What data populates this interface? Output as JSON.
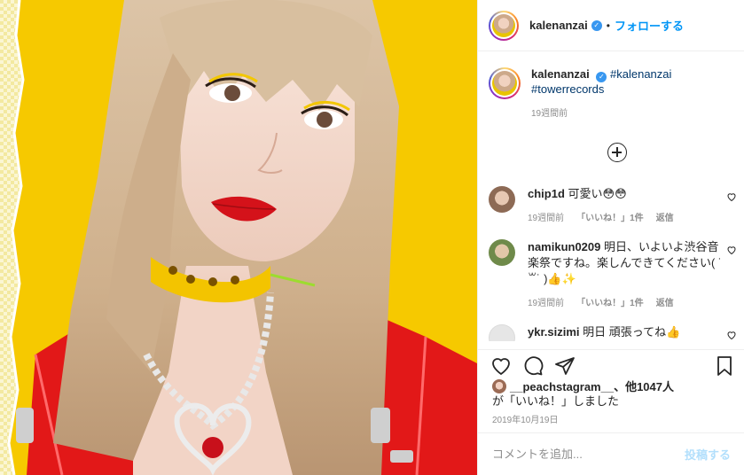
{
  "post": {
    "author": "kalenanzai",
    "follow_label": "フォローする",
    "separator": "•"
  },
  "caption": {
    "author": "kalenanzai",
    "hashtags": [
      "#kalenanzai",
      "#towerrecords"
    ],
    "time": "19週間前"
  },
  "comments": [
    {
      "user": "chip1d",
      "text": "可愛い😳😳",
      "time": "19週間前",
      "likes": "「いいね！」1件",
      "reply": "返信"
    },
    {
      "user": "namikun0209",
      "text": "明日、いよいよ渋谷音楽祭ですね。楽しんできてください( ˙꒳˙ )👍✨",
      "time": "19週間前",
      "likes": "「いいね！」1件",
      "reply": "返信"
    },
    {
      "user": "ykr.sizimi",
      "text": "明日 頑張ってね👍"
    }
  ],
  "likes": {
    "user": "__peachstagram__",
    "others": "、他1047人",
    "suffix": "が「いいね！」しました"
  },
  "date": "2019年10月19日",
  "comment_input": {
    "placeholder": "コメントを追加...",
    "post_label": "投稿する"
  },
  "icons": {
    "like": "heart-icon",
    "comment": "comment-icon",
    "share": "share-icon",
    "save": "bookmark-icon",
    "load_more": "plus-circle-icon",
    "verified": "verified-badge-icon"
  },
  "colors": {
    "accent": "#0095f6",
    "hashtag": "#00376b",
    "muted": "#8e8e8e",
    "verified": "#3897f0",
    "photo_background": "#f6c900"
  }
}
